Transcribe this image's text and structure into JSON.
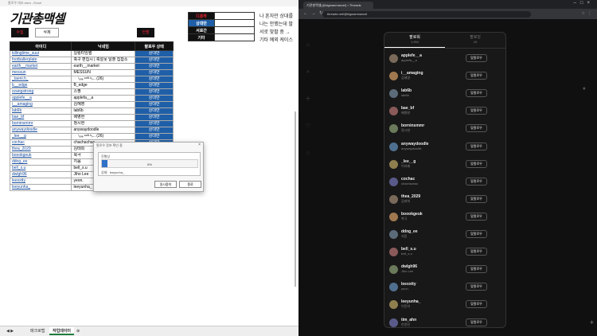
{
  "excel": {
    "window_title": "팔로우 대조.xlsm - Excel",
    "logo": "기관총맥셀",
    "buttons": {
      "collect": "수집",
      "delete": "삭제",
      "unfollow": "언팔"
    },
    "legend": [
      {
        "label": "",
        "value": "디홍하"
      },
      {
        "label": "",
        "value": "상대만"
      },
      {
        "label": "서로간",
        "value": ""
      },
      {
        "label": "기타",
        "value": ""
      }
    ],
    "note_lines": [
      "나 혼자만 상대를",
      "나는 안했는데 팔",
      "서로 맞팔 중 →",
      "기타 예외 케이스"
    ],
    "headers": [
      "아이디",
      "닉네임",
      "팔로우 상태"
    ],
    "rows": [
      {
        "id": "killingtime_suui",
        "nick": "킬링타임썰",
        "status": "상대만"
      },
      {
        "id": "footballerplate",
        "nick": "축구 편집시 | 축알못 탈출 집합소",
        "status": "상대만"
      },
      {
        "id": "earth__market",
        "nick": "earth__market",
        "status": "상대만"
      },
      {
        "id": "messun",
        "nick": "MESSUN",
        "status": "상대만"
      },
      {
        "id": "_taeni.h_",
        "nick": "ᆞ ˡₒᵥₑ ᵉᵒᴺ ᵏᵢ... (26)",
        "status": "상대만"
      },
      {
        "id": "b__edge",
        "nick": "B_edge",
        "status": "상대만"
      },
      {
        "id": "zzangstrong",
        "nick": "스짱",
        "status": "상대만"
      },
      {
        "id": "applefe__a",
        "nick": "applefa__a",
        "status": "상대만"
      },
      {
        "id": "i__amaging",
        "nick": "김혜영",
        "status": "상대만"
      },
      {
        "id": "lab6b",
        "nick": "lab6b",
        "status": "상대만"
      },
      {
        "id": "bae_bf",
        "nick": "배병현",
        "status": "상대만"
      },
      {
        "id": "borninsmmr",
        "nick": "정시현",
        "status": "상대만"
      },
      {
        "id": "anywaydoodle",
        "nick": "anywaydoodle",
        "status": "상대만"
      },
      {
        "id": "_lee__g",
        "nick": "ᆞ ˡₒᵥₑ ᵉᵒᴺ ᵏᵢ... (26)",
        "status": "상대만"
      },
      {
        "id": "cochac",
        "nick": "chachachac",
        "status": "상대만"
      },
      {
        "id": "thea_2029",
        "nick": "김태희",
        "status": "상대만"
      },
      {
        "id": "boookgeuk",
        "nick": "북극",
        "status": "상대만"
      },
      {
        "id": "ddng_ee",
        "nick": "지음",
        "status": "상대만"
      },
      {
        "id": "bell_s.u",
        "nick": "bell_s.u",
        "status": "상대만"
      },
      {
        "id": "dwlgh96",
        "nick": "Jiho Lee",
        "status": "상대만"
      },
      {
        "id": "leexxtty",
        "nick": "yeon.",
        "status": "상대만"
      },
      {
        "id": "leeyunha_",
        "nick": "leeyunha_",
        "status": "상대만"
      }
    ],
    "sheet_tabs": [
      "매크로탭",
      "작업데이터"
    ],
    "dialog": {
      "title": "팔로우 정보 확인 중",
      "progress_label": "진행상",
      "progress_text": "6%",
      "progress": 0.06,
      "current_label": "상태:",
      "current_value": "leeyunha_",
      "btn_stop": "일시중지",
      "btn_close": "종료"
    }
  },
  "browser": {
    "tab_title": "기관총맥셀(@kigwanmaxcel) • Threads",
    "url": "threads.net/@kigwanmaxcel",
    "modal": {
      "tabs": [
        {
          "label": "팔로워",
          "count": "1,994"
        },
        {
          "label": "팔로잉",
          "count": "10"
        }
      ],
      "follow_label": "맞팔로우",
      "users": [
        {
          "username": "applefe__a",
          "name": "applefa__a"
        },
        {
          "username": "i__amaging",
          "name": "김혜영"
        },
        {
          "username": "lab6b",
          "name": "lab6b"
        },
        {
          "username": "bae_bf",
          "name": "배병현"
        },
        {
          "username": "borninsmmr",
          "name": "정시현"
        },
        {
          "username": "anywaydoodle",
          "name": "anywaydoodle"
        },
        {
          "username": "_lee__g",
          "name": "이지혜"
        },
        {
          "username": "cochac",
          "name": "chachachac"
        },
        {
          "username": "thea_2029",
          "name": "김태희"
        },
        {
          "username": "boookgeuk",
          "name": "북극"
        },
        {
          "username": "ddng_ee",
          "name": "지음"
        },
        {
          "username": "bell_s.u",
          "name": "bell_s.u"
        },
        {
          "username": "dwlgh96",
          "name": "Jiho Lee"
        },
        {
          "username": "leexxtty",
          "name": "yeon."
        },
        {
          "username": "leeyunha_",
          "name": "이윤하"
        },
        {
          "username": "tim_ahn",
          "name": "안정민"
        }
      ]
    }
  }
}
